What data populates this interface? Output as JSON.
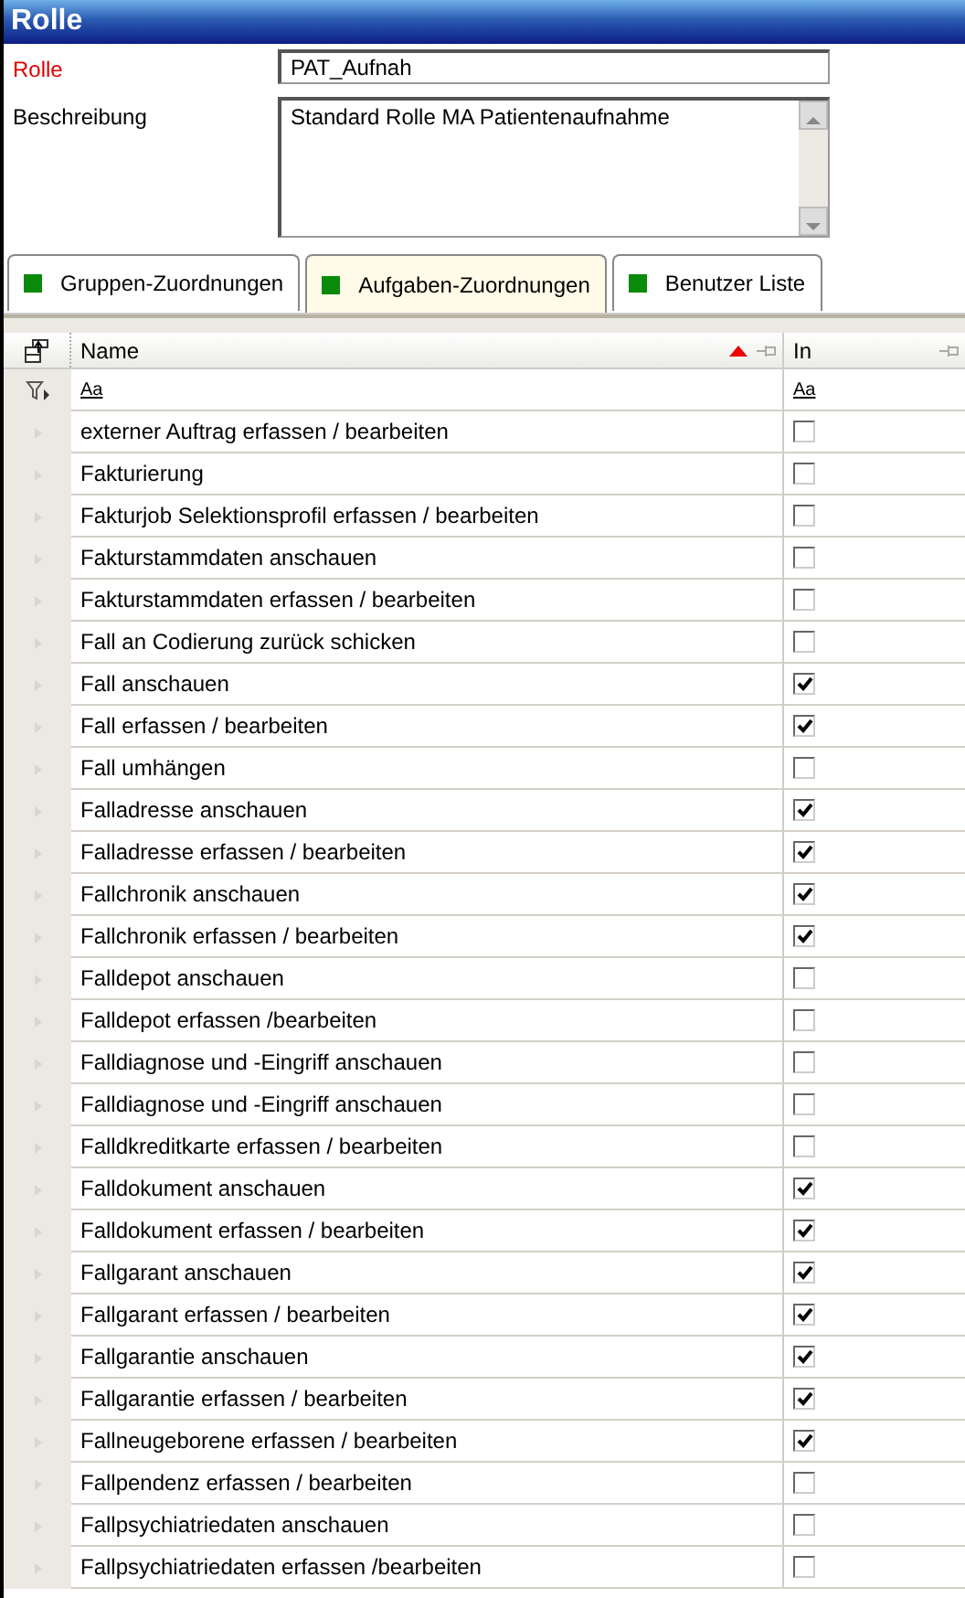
{
  "window": {
    "title": "Rolle"
  },
  "form": {
    "fields": [
      {
        "label": "Rolle",
        "kind": "input",
        "required": true,
        "value": "PAT_Aufnah"
      },
      {
        "label": "Beschreibung",
        "kind": "textarea",
        "required": false,
        "value": "Standard Rolle MA Patientenaufnahme"
      }
    ]
  },
  "tabs": [
    {
      "label": "Gruppen-Zuordnungen",
      "selected": false
    },
    {
      "label": "Aufgaben-Zuordnungen",
      "selected": true
    },
    {
      "label": "Benutzer Liste",
      "selected": false
    }
  ],
  "table": {
    "columns": [
      {
        "label": "Name",
        "sorted": true
      },
      {
        "label": "In",
        "sorted": false
      }
    ],
    "filters": [
      "Aa",
      "Aa"
    ],
    "rows": [
      {
        "name": "externer Auftrag erfassen / bearbeiten",
        "checked": false
      },
      {
        "name": "Fakturierung",
        "checked": false
      },
      {
        "name": "Fakturjob Selektionsprofil erfassen / bearbeiten",
        "checked": false
      },
      {
        "name": "Fakturstammdaten anschauen",
        "checked": false
      },
      {
        "name": "Fakturstammdaten erfassen / bearbeiten",
        "checked": false
      },
      {
        "name": "Fall an Codierung zurück schicken",
        "checked": false
      },
      {
        "name": "Fall anschauen",
        "checked": true
      },
      {
        "name": "Fall erfassen / bearbeiten",
        "checked": true
      },
      {
        "name": "Fall umhängen",
        "checked": false
      },
      {
        "name": "Falladresse anschauen",
        "checked": true
      },
      {
        "name": "Falladresse erfassen / bearbeiten",
        "checked": true
      },
      {
        "name": "Fallchronik anschauen",
        "checked": true
      },
      {
        "name": "Fallchronik erfassen / bearbeiten",
        "checked": true
      },
      {
        "name": "Falldepot anschauen",
        "checked": false
      },
      {
        "name": "Falldepot erfassen /bearbeiten",
        "checked": false
      },
      {
        "name": "Falldiagnose und -Eingriff anschauen",
        "checked": false
      },
      {
        "name": "Falldiagnose und -Eingriff anschauen",
        "checked": false
      },
      {
        "name": "Falldkreditkarte erfassen / bearbeiten",
        "checked": false
      },
      {
        "name": "Falldokument anschauen",
        "checked": true
      },
      {
        "name": "Falldokument erfassen / bearbeiten",
        "checked": true
      },
      {
        "name": "Fallgarant anschauen",
        "checked": true
      },
      {
        "name": "Fallgarant erfassen / bearbeiten",
        "checked": true
      },
      {
        "name": "Fallgarantie anschauen",
        "checked": true
      },
      {
        "name": "Fallgarantie erfassen / bearbeiten",
        "checked": true
      },
      {
        "name": "Fallneugeborene erfassen / bearbeiten",
        "checked": true
      },
      {
        "name": "Fallpendenz erfassen / bearbeiten",
        "checked": false
      },
      {
        "name": "Fallpsychiatriedaten anschauen",
        "checked": false
      },
      {
        "name": "Fallpsychiatriedaten erfassen /bearbeiten",
        "checked": false
      }
    ]
  }
}
